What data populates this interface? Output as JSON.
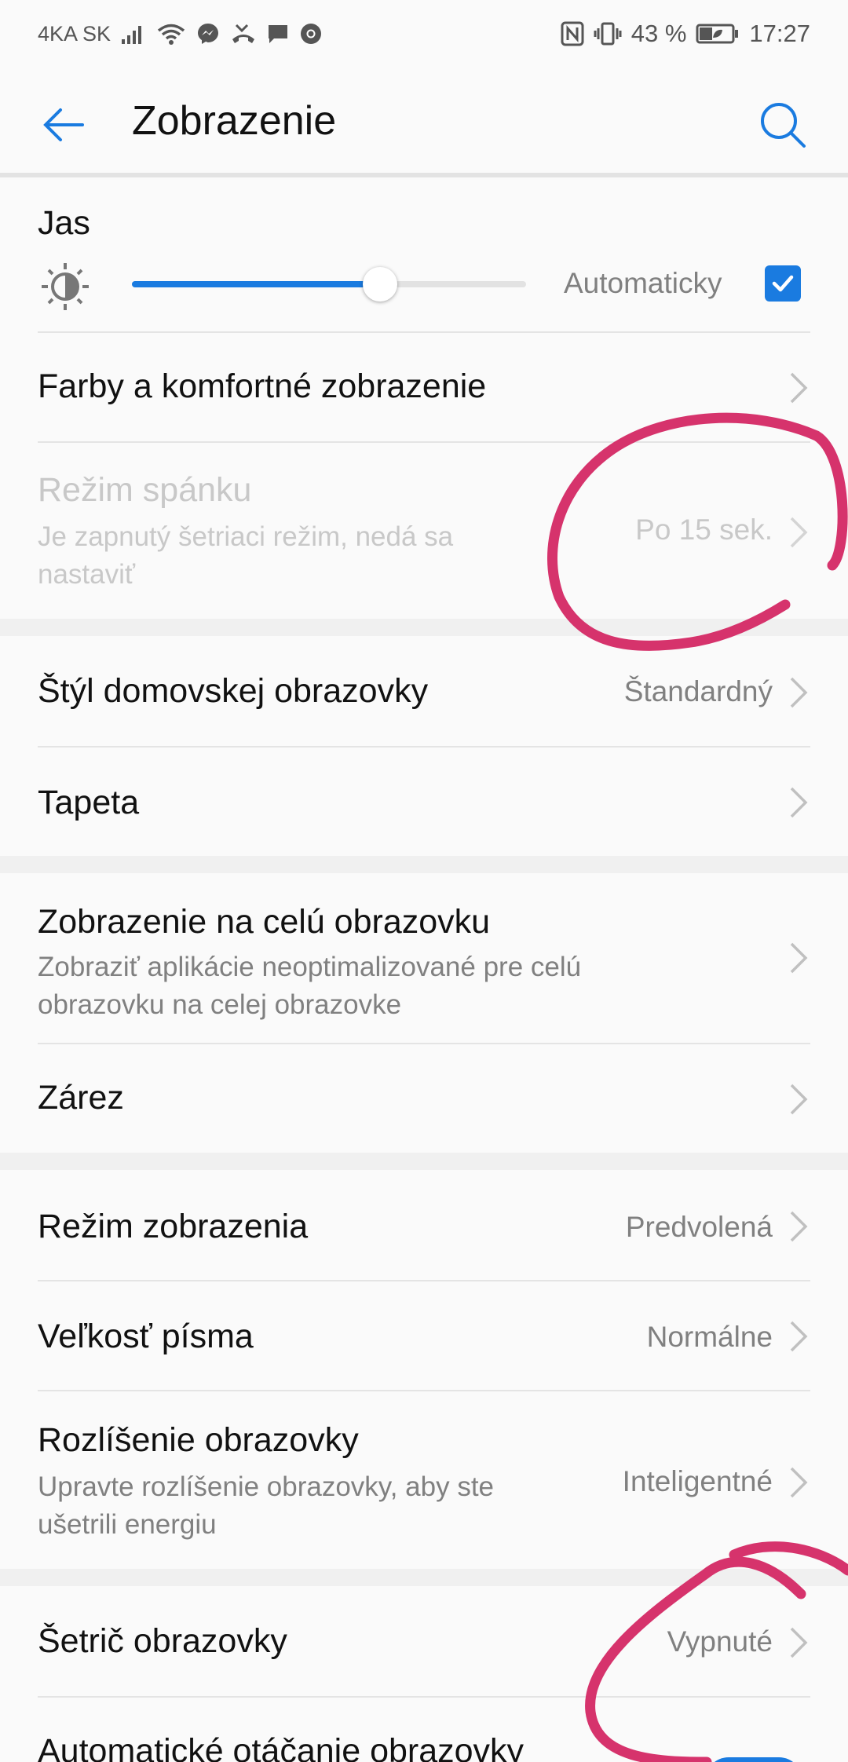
{
  "status_bar": {
    "carrier": "4KA SK",
    "battery": "43 %",
    "time": "17:27",
    "icons": [
      "signal-icon",
      "wifi-icon",
      "messenger-icon",
      "missed-call-icon",
      "message-icon",
      "chrome-icon",
      "nfc-icon",
      "vibrate-icon",
      "battery-saver-icon"
    ]
  },
  "app_bar": {
    "title": "Zobrazenie"
  },
  "brightness": {
    "title": "Jas",
    "auto_label": "Automaticky",
    "auto_checked": true,
    "level": 0.63
  },
  "rows": {
    "colors": {
      "title": "Farby a komfortné zobrazenie"
    },
    "sleep": {
      "title": "Režim spánku",
      "subtitle": "Je zapnutý šetriaci režim, nedá sa nastaviť",
      "value": "Po 15 sek.",
      "enabled": false
    },
    "home_style": {
      "title": "Štýl domovskej obrazovky",
      "value": "Štandardný"
    },
    "wallpaper": {
      "title": "Tapeta"
    },
    "fullscreen": {
      "title": "Zobrazenie na celú obrazovku",
      "subtitle": "Zobraziť aplikácie neoptimalizované pre celú obrazovku na celej obrazovke"
    },
    "notch": {
      "title": "Zárez"
    },
    "display_mode": {
      "title": "Režim zobrazenia",
      "value": "Predvolená"
    },
    "font_size": {
      "title": "Veľkosť písma",
      "value": "Normálne"
    },
    "resolution": {
      "title": "Rozlíšenie obrazovky",
      "subtitle": "Upravte rozlíšenie obrazovky, aby ste ušetrili energiu",
      "value": "Inteligentné"
    },
    "screensaver": {
      "title": "Šetrič obrazovky",
      "value": "Vypnuté"
    },
    "auto_rotate": {
      "title": "Automatické otáčanie obrazovky",
      "toggle_on": true
    }
  },
  "colors": {
    "accent": "#1a7be0",
    "annotation": "#d6336c"
  }
}
